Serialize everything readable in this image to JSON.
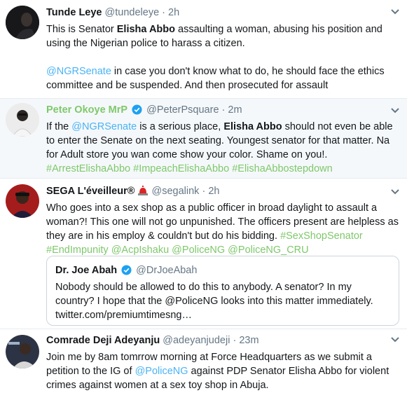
{
  "tweets": [
    {
      "name": "Tunde Leye",
      "handle": "@tundeleye",
      "sep": "·",
      "time": "2h",
      "p1": [
        "This is Senator ",
        "Elisha Abbo",
        " assaulting a woman, abusing his position and using the Nigerian police to harass a citizen."
      ],
      "p2": [
        "@NGRSenate",
        " in case you don't know what to do, he should face the ethics committee and be suspended. And then prosecuted for assault"
      ]
    },
    {
      "name": "Peter Okoye MrP",
      "handle": "@PeterPsquare",
      "sep": "·",
      "time": "2m",
      "text": [
        "If the ",
        "@NGRSenate",
        " is a serious place, ",
        "Elisha Abbo",
        " should not even be able to enter the Senate on the next seating. Youngest senator for that matter. Na for Adult store you wan come show your color. Shame on you!.  ",
        "#ArrestElishaAbbo",
        " ",
        "#ImpeachElishaAbbo",
        " ",
        "#ElishaAbbostepdown"
      ]
    },
    {
      "name": "SEGA L'éveilleur®",
      "handle": "@segalink",
      "sep": "·",
      "time": "2h",
      "text": [
        "Who goes into a sex shop as a public officer in broad daylight to assault a woman?! This one will not go unpunished. The officers present are helpless as they are in his employ & couldn't but do his bidding. ",
        "#SexShopSenator",
        " ",
        "#EndImpunity",
        " ",
        "@AcpIshaku",
        " ",
        "@PoliceNG",
        " ",
        "@PoliceNG_CRU"
      ]
    },
    {
      "name": "Comrade Deji Adeyanju",
      "handle": "@adeyanjudeji",
      "sep": "·",
      "time": "23m",
      "text": [
        "Join me by 8am tomrrow morning at Force Headquarters as we submit a petition to the IG of ",
        "@PoliceNG",
        " against PDP Senator Elisha Abbo for violent crimes against women at a sex toy shop in Abuja."
      ]
    }
  ],
  "quote": {
    "name": "Dr. Joe Abah",
    "handle": "@DrJoeAbah",
    "text": "Nobody should be allowed to do this to anybody. A senator? In my country? I hope that the @PoliceNG looks into this matter immediately. twitter.com/premiumtimesng…"
  },
  "colors": {
    "link": "#4ab3f4",
    "hashtag": "#7ec86b",
    "name_highlight": "#7ec86b",
    "verified": "#1da1f2",
    "border": "#e6ecf0"
  },
  "icons": [
    "chevron-down-icon",
    "verified-badge-icon",
    "siren-emoji-icon"
  ]
}
